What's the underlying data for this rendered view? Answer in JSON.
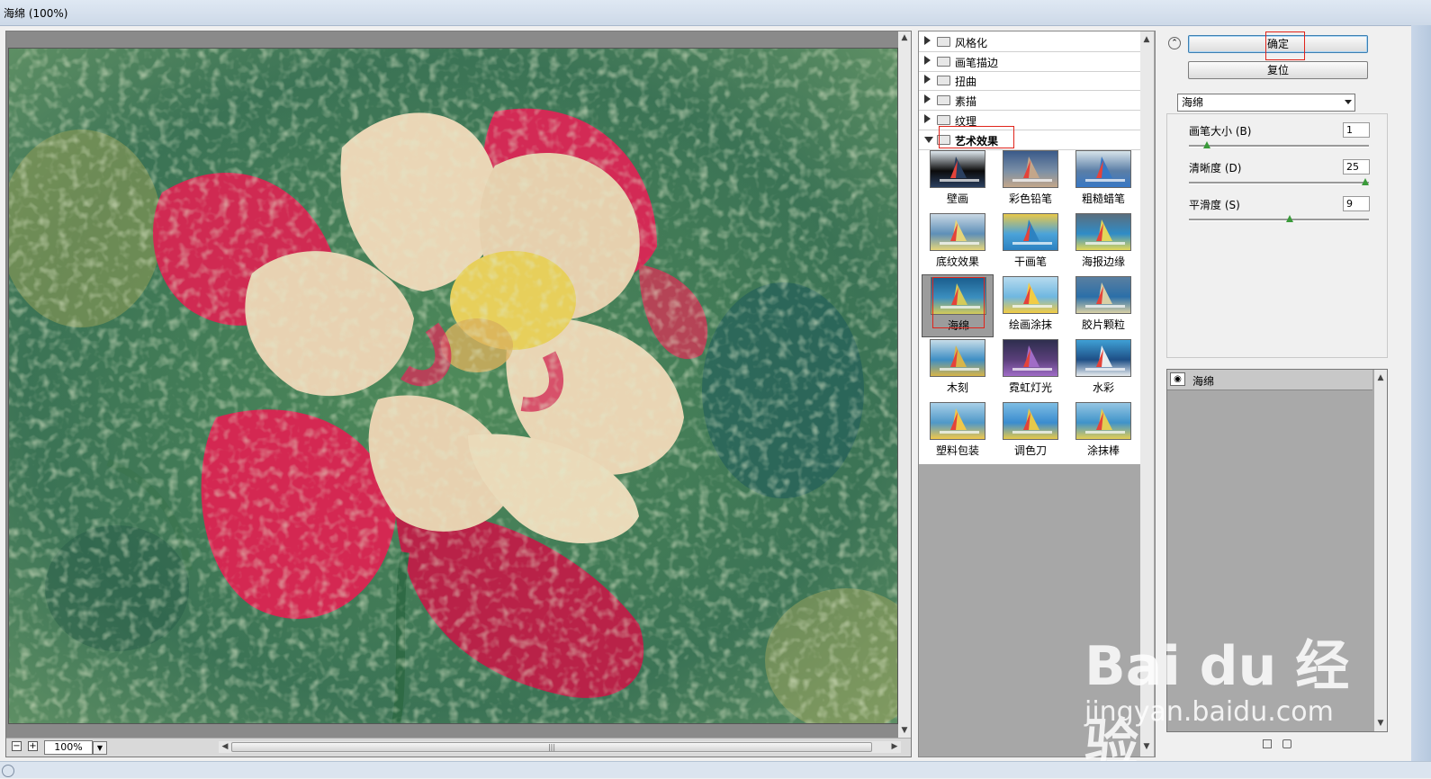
{
  "window": {
    "title": "海绵 (100%)"
  },
  "preview": {
    "zoom": "100%",
    "zoom_minus": "−",
    "zoom_plus": "+"
  },
  "filter_tree": {
    "categories": [
      {
        "label": "风格化",
        "expanded": false
      },
      {
        "label": "画笔描边",
        "expanded": false
      },
      {
        "label": "扭曲",
        "expanded": false
      },
      {
        "label": "素描",
        "expanded": false
      },
      {
        "label": "纹理",
        "expanded": false
      },
      {
        "label": "艺术效果",
        "expanded": true
      }
    ],
    "thumbnails": [
      "壁画",
      "彩色铅笔",
      "粗糙蜡笔",
      "底纹效果",
      "干画笔",
      "海报边缘",
      "海绵",
      "绘画涂抹",
      "胶片颗粒",
      "木刻",
      "霓虹灯光",
      "水彩",
      "塑料包装",
      "调色刀",
      "涂抹棒"
    ],
    "selected": "海绵"
  },
  "panel": {
    "ok_label": "确定",
    "reset_label": "复位",
    "filter_select": "海绵",
    "params": [
      {
        "label": "画笔大小 (B)",
        "value": "1",
        "fraction": 0.1
      },
      {
        "label": "清晰度 (D)",
        "value": "25",
        "fraction": 1.0
      },
      {
        "label": "平滑度 (S)",
        "value": "9",
        "fraction": 0.57
      }
    ],
    "layer_name": "海绵"
  },
  "watermark": {
    "logo": "Bai du 经验",
    "url": "jingyan.baidu.com"
  },
  "colors": {
    "accent_red": "#e0241b",
    "slider_knob": "#3a9a3a",
    "selected_thumb": "#9c9c9c"
  }
}
